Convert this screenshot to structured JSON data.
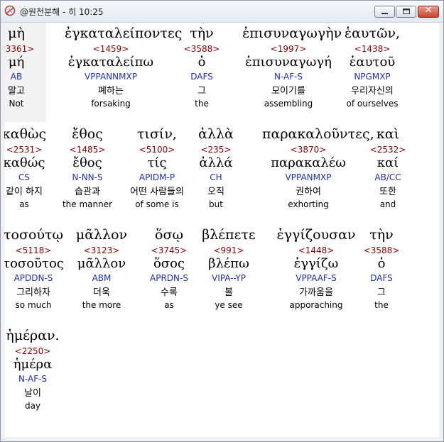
{
  "window": {
    "title": "@원전분해 - 히 10:25"
  },
  "rows": [
    {
      "words": [
        {
          "greek": "μὴ",
          "strong": "<3361>",
          "lemma": "μή",
          "parsing": "AB",
          "korean": "말고",
          "english": "Not"
        },
        {
          "greek": "ἐγκαταλείποντες",
          "strong": "<1459>",
          "lemma": "ἐγκαταλείπω",
          "parsing": "VPPANNMXP",
          "korean": "폐하는",
          "english": "forsaking"
        },
        {
          "greek": "τὴν",
          "strong": "<3588>",
          "lemma": "ὁ",
          "parsing": "DAFS",
          "korean": "그",
          "english": "the"
        },
        {
          "greek": "ἐπισυναγωγὴν",
          "strong": "<1997>",
          "lemma": "ἐπισυναγωγή",
          "parsing": "N-AF-S",
          "korean": "모이기를",
          "english": "assembling"
        },
        {
          "greek": "ἑαυτῶν,",
          "strong": "<1438>",
          "lemma": "ἑαυτοῦ",
          "parsing": "NPGMXP",
          "korean": "우리자신의",
          "english": "of ourselves"
        }
      ]
    },
    {
      "words": [
        {
          "greek": "καθὼς",
          "strong": "<2531>",
          "lemma": "καθώς",
          "parsing": "CS",
          "korean": "같이 하지",
          "english": "as"
        },
        {
          "greek": "ἔθος",
          "strong": "<1485>",
          "lemma": "ἔθος",
          "parsing": "N-NN-S",
          "korean": "습관과",
          "english": "the manner"
        },
        {
          "greek": "τισίν,",
          "strong": "<5100>",
          "lemma": "τίς",
          "parsing": "APIDM-P",
          "korean": "어떤 사람들의",
          "english": "of some is"
        },
        {
          "greek": "ἀλλὰ",
          "strong": "<235>",
          "lemma": "ἀλλά",
          "parsing": "CH",
          "korean": "오직",
          "english": "but"
        },
        {
          "greek": "παρακαλοῦντες,",
          "strong": "<3870>",
          "lemma": "παρακαλέω",
          "parsing": "VPPANMXP",
          "korean": "권하여",
          "english": "exhorting"
        },
        {
          "greek": "καὶ",
          "strong": "<2532>",
          "lemma": "καί",
          "parsing": "AB/CC",
          "korean": "또한",
          "english": "and"
        }
      ]
    },
    {
      "words": [
        {
          "greek": "τοσούτῳ",
          "strong": "<5118>",
          "lemma": "τοσοῦτος",
          "parsing": "APDDN-S",
          "korean": "그리하자",
          "english": "so much"
        },
        {
          "greek": "μᾶλλον",
          "strong": "<3123>",
          "lemma": "μᾶλλον",
          "parsing": "ABM",
          "korean": "더욱",
          "english": "the more"
        },
        {
          "greek": "ὅσῳ",
          "strong": "<3745>",
          "lemma": "ὅσος",
          "parsing": "APRDN-S",
          "korean": "수록",
          "english": "as"
        },
        {
          "greek": "βλέπετε",
          "strong": "<991>",
          "lemma": "βλέπω",
          "parsing": "VIPA--YP",
          "korean": "볼",
          "english": "ye see"
        },
        {
          "greek": "ἐγγίζουσαν",
          "strong": "<1448>",
          "lemma": "ἐγγίζω",
          "parsing": "VPPAAF-S",
          "korean": "가까움을",
          "english": "apporaching"
        },
        {
          "greek": "τὴν",
          "strong": "<3588>",
          "lemma": "ὁ",
          "parsing": "DAFS",
          "korean": "그",
          "english": "the"
        }
      ]
    },
    {
      "words": [
        {
          "greek": "ἡμέραν.",
          "strong": "<2250>",
          "lemma": "ἡμέρα",
          "parsing": "N-AF-S",
          "korean": "날이",
          "english": "day"
        }
      ]
    }
  ]
}
